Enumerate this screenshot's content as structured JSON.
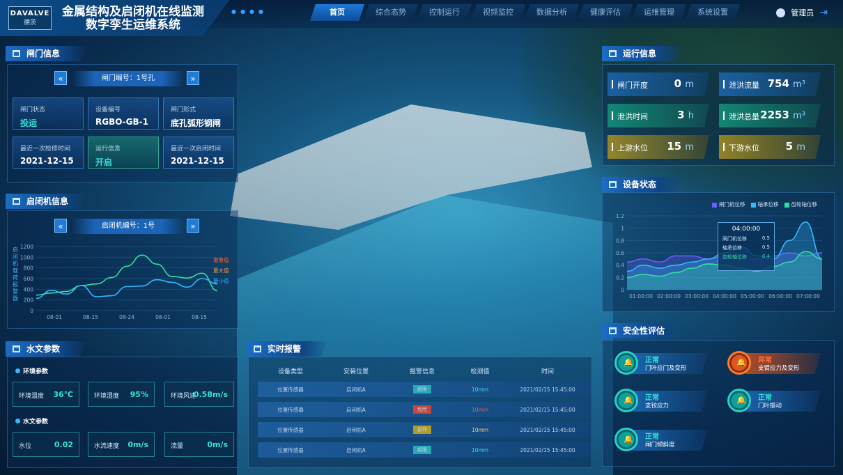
{
  "header": {
    "logo_text": "DAVALVE",
    "logo_sub": "德茨",
    "title_line1": "金属结构及启闭机在线监测",
    "title_line2": "数字孪生运维系统",
    "nav": [
      "首页",
      "综合态势",
      "控制运行",
      "视频监控",
      "数据分析",
      "健康评估",
      "运维管理",
      "系统设置"
    ],
    "active_nav": "首页",
    "user": "管理员"
  },
  "gate": {
    "title": "闸门信息",
    "selector": "闸门编号：1号孔",
    "cards": [
      {
        "k": "闸门状态",
        "v": "投运"
      },
      {
        "k": "设备编号",
        "v": "RGBO-GB-1"
      },
      {
        "k": "闸门形式",
        "v": "底孔弧形钢闸"
      },
      {
        "k": "最近一次检修时间",
        "v": "2021-12-15"
      },
      {
        "k": "运行信息",
        "v": "开启"
      },
      {
        "k": "最近一次启闭时间",
        "v": "2021-12-15"
      }
    ]
  },
  "hoist": {
    "title": "启闭机信息",
    "selector": "启闭机编号：1号",
    "ylabel": "启闭机载荷报警器",
    "legend": [
      "报警值",
      "最大值",
      "最小值"
    ]
  },
  "hoist_chart": {
    "type": "line",
    "yticks": [
      "1200",
      "1000",
      "800",
      "600",
      "400",
      "200",
      "0"
    ],
    "xticks": [
      "08-01",
      "08-15",
      "08-24",
      "08-01",
      "08-15"
    ],
    "ylim": [
      0,
      1200
    ],
    "series": [
      {
        "name": "最大值",
        "color": "#2fe0a0",
        "values": [
          290,
          330,
          360,
          470,
          500,
          620,
          830,
          1040,
          870,
          640,
          610,
          700,
          370
        ]
      },
      {
        "name": "最小值",
        "color": "#35b8ff",
        "values": [
          230,
          380,
          310,
          470,
          260,
          280,
          450,
          460,
          580,
          530,
          440,
          600,
          500
        ]
      }
    ]
  },
  "hydro": {
    "title": "水文参数",
    "env_title": "环境参数",
    "env": [
      {
        "k": "环境温度",
        "v": "36℃"
      },
      {
        "k": "环境湿度",
        "v": "95%"
      },
      {
        "k": "环境风速",
        "v": "0.58m/s"
      }
    ],
    "water_title": "水文参数",
    "water": [
      {
        "k": "水位",
        "v": "0.02"
      },
      {
        "k": "水流速度",
        "v": "0m/s"
      },
      {
        "k": "流量",
        "v": "0m/s"
      }
    ]
  },
  "alarm": {
    "title": "实时报警",
    "headers": [
      "设备类型",
      "安装位置",
      "报警信息",
      "检测值",
      "时间"
    ],
    "rows": [
      {
        "type": "位置传感器",
        "pos": "启闭机A",
        "info": "超限",
        "val": "10mm",
        "time": "2021/02/15 15:45:00",
        "info_color": "#2aa8b8",
        "val_color": "#35e2d6"
      },
      {
        "type": "位置传感器",
        "pos": "启闭机A",
        "info": "危险",
        "val": "10mm",
        "time": "2021/02/15 15:45:00",
        "info_color": "#c8463a",
        "val_color": "#ff5a4a"
      },
      {
        "type": "位置传感器",
        "pos": "启闭机A",
        "info": "损坏",
        "val": "10mm",
        "time": "2021/02/15 15:45:00",
        "info_color": "#b09a2a",
        "val_color": "#ffd24a"
      },
      {
        "type": "位置传感器",
        "pos": "启闭机A",
        "info": "超限",
        "val": "10mm",
        "time": "2021/02/15 15:45:00",
        "info_color": "#2aa8b8",
        "val_color": "#35e2d6"
      }
    ]
  },
  "run": {
    "title": "运行信息",
    "items": [
      {
        "k": "闸门开度",
        "v": "0",
        "u": "m",
        "style": "blue"
      },
      {
        "k": "泄洪流量",
        "v": "754",
        "u": "m³",
        "style": "blue"
      },
      {
        "k": "泄洪时间",
        "v": "3",
        "u": "h",
        "style": "green"
      },
      {
        "k": "泄洪总量",
        "v": "2253",
        "u": "m³",
        "style": "green"
      },
      {
        "k": "上游水位",
        "v": "15",
        "u": "m",
        "style": "yellow"
      },
      {
        "k": "下游水位",
        "v": "5",
        "u": "m",
        "style": "yellow"
      }
    ]
  },
  "device": {
    "title": "设备状态",
    "legend": [
      {
        "name": "闸门机位移",
        "color": "#6a5cff"
      },
      {
        "name": "轴承位移",
        "color": "#35b8ff"
      },
      {
        "name": "齿轮轴位移",
        "color": "#2fe0a0"
      }
    ],
    "tooltip_time": "04:00:00",
    "tooltip_rows": [
      {
        "k": "闸门机位移",
        "v": "0.5"
      },
      {
        "k": "轴承位移",
        "v": "0.5"
      },
      {
        "k": "齿轮轴位移",
        "v": "0.4"
      }
    ]
  },
  "device_chart": {
    "type": "area",
    "yticks": [
      "1.2",
      "1",
      "0.8",
      "0.6",
      "0.4",
      "0.2",
      "0"
    ],
    "xticks": [
      "01:00:00",
      "02:00:00",
      "03:00:00",
      "04:00:00",
      "05:00:00",
      "06:00:00",
      "07:00:00"
    ],
    "ylim": [
      0,
      1.2
    ],
    "series": [
      {
        "name": "闸门机位移",
        "color": "#6a5cff",
        "values": [
          0.45,
          0.5,
          0.45,
          0.55,
          0.55,
          0.5,
          0.55,
          0.5,
          0.5,
          0.55,
          0.6,
          0.55,
          0.6
        ]
      },
      {
        "name": "轴承位移",
        "color": "#35b8ff",
        "values": [
          0.3,
          0.4,
          0.35,
          0.4,
          0.45,
          0.5,
          0.6,
          0.7,
          0.55,
          0.5,
          0.8,
          1.1,
          0.5
        ]
      },
      {
        "name": "齿轮轴位移",
        "color": "#2fe0a0",
        "values": [
          0.2,
          0.25,
          0.22,
          0.28,
          0.35,
          0.42,
          0.4,
          0.35,
          0.3,
          0.38,
          0.45,
          0.62,
          0.5
        ]
      }
    ]
  },
  "safety": {
    "title": "安全性评估",
    "items": [
      {
        "st": "正常",
        "nm": "门叶应门及变形",
        "red": false
      },
      {
        "st": "异常",
        "nm": "支臂应力及变形",
        "red": true
      },
      {
        "st": "正常",
        "nm": "支铰应力",
        "red": false
      },
      {
        "st": "正常",
        "nm": "门叶振动",
        "red": false
      },
      {
        "st": "正常",
        "nm": "闸门倾斜度",
        "red": false
      }
    ]
  }
}
